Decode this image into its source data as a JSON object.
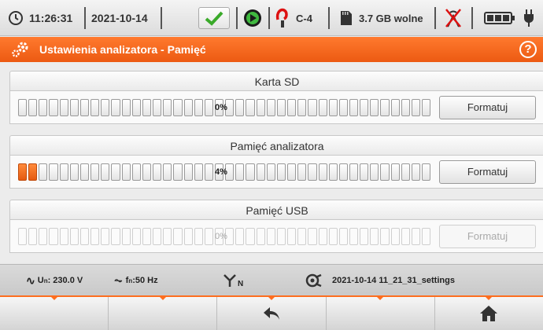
{
  "statusbar": {
    "time": "11:26:31",
    "date": "2021-10-14",
    "channel": "C-4",
    "storage": "3.7 GB wolne"
  },
  "titlebar": {
    "title": "Ustawienia analizatora - Pamięć",
    "help": "?"
  },
  "sections": [
    {
      "title": "Karta SD",
      "percent_label": "0%",
      "used_fraction": 0.0,
      "button": "Formatuj",
      "enabled": true
    },
    {
      "title": "Pamięć analizatora",
      "percent_label": "4%",
      "used_fraction": 0.04,
      "button": "Formatuj",
      "enabled": true
    },
    {
      "title": "Pamięć USB",
      "percent_label": "0%",
      "used_fraction": 0.0,
      "button": "Formatuj",
      "enabled": false
    }
  ],
  "infobar": {
    "un_prefix": "U",
    "un_sub": "n",
    "un_value": ": 230.0 V",
    "fn_prefix": "f",
    "fn_sub": "n",
    "fn_value": ":50 Hz",
    "network_sub": "N",
    "settings_file": "2021-10-14 11_21_31_settings"
  },
  "softkeys": [
    "",
    "",
    "back-arrow-icon",
    "",
    "home-icon"
  ]
}
